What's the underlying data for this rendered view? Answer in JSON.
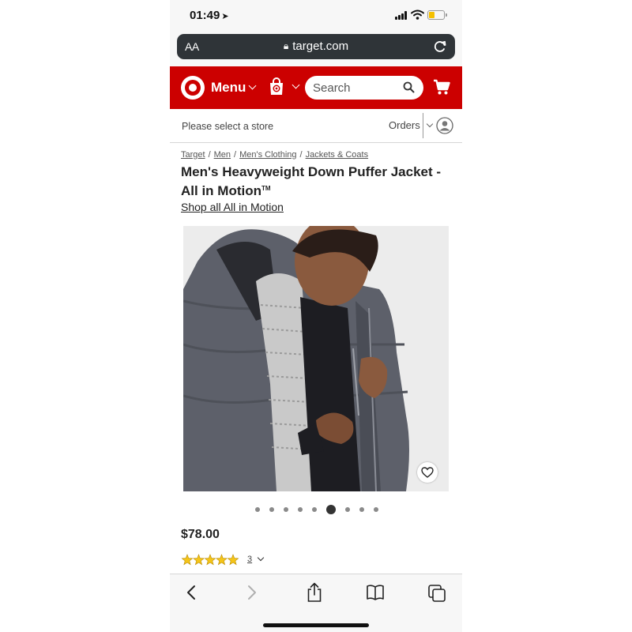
{
  "status_bar": {
    "time": "01:49",
    "location_icon": "location-arrow-icon",
    "battery_color": "#f5c000"
  },
  "browser": {
    "text_size_label": "AA",
    "domain": "target.com"
  },
  "header": {
    "brand_color": "#cc0000",
    "menu_label": "Menu",
    "search_placeholder": "Search"
  },
  "store_row": {
    "select_store": "Please select a store",
    "orders_label": "Orders"
  },
  "breadcrumb": [
    "Target",
    "Men",
    "Men's Clothing",
    "Jackets & Coats"
  ],
  "product": {
    "title": "Men's Heavyweight Down Puffer Jacket - All in Motion",
    "trademark": "TM",
    "shop_all_link": "Shop all All in Motion",
    "price": "$78.00",
    "rating_stars": 5,
    "rating_count": "3",
    "image_count": 9,
    "active_image_index": 5
  },
  "toolbar": {
    "back_icon": "chevron-left-icon",
    "forward_icon": "chevron-right-icon",
    "share_icon": "share-icon",
    "bookmarks_icon": "book-icon",
    "tabs_icon": "tabs-icon"
  }
}
